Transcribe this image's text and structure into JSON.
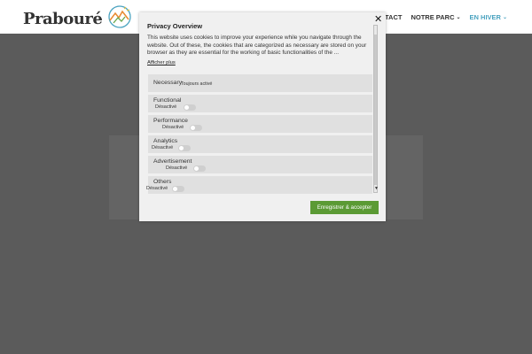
{
  "header": {
    "logo_text": "Prabouré",
    "nav": [
      {
        "label": "CONTACT",
        "has_chevron": false,
        "active": false
      },
      {
        "label": "NOTRE PARC",
        "has_chevron": true,
        "active": false
      },
      {
        "label": "EN HIVER",
        "has_chevron": true,
        "active": true
      }
    ],
    "nav_chevron": "⌄",
    "hidden_chevron": "⌄"
  },
  "modal": {
    "title": "Privacy Overview",
    "description": "This website uses cookies to improve your experience while you navigate through the website. Out of these, the cookies that are categorized as necessary are stored on your browser as they are essential for the working of basic functionalities of the ...",
    "show_more": "Afficher plus",
    "close_icon": "✕",
    "categories": [
      {
        "label": "Necessary",
        "status": "Toujours activé"
      },
      {
        "label": "Functional",
        "status": "Désactivé"
      },
      {
        "label": "Performance",
        "status": "Désactivé"
      },
      {
        "label": "Analytics",
        "status": "Désactivé"
      },
      {
        "label": "Advertisement",
        "status": "Désactivé"
      },
      {
        "label": "Others",
        "status": "Désactivé"
      }
    ],
    "save_button": "Enregistrer & accepter"
  },
  "colors": {
    "accent_active_nav": "#4aa3c0",
    "save_button": "#5b9a34",
    "backdrop": "#5b5b5b"
  }
}
